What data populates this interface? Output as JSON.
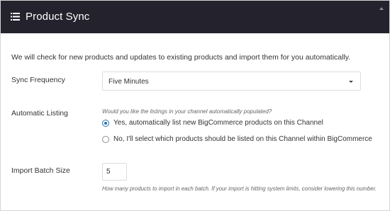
{
  "panel": {
    "title": "Product Sync",
    "header_icon": "list-icon",
    "collapse_icon": "triangle-up-icon"
  },
  "intro_text": "We will check for new products and updates to existing products and import them for you automatically.",
  "sync_frequency": {
    "label": "Sync Frequency",
    "selected": "Five Minutes"
  },
  "automatic_listing": {
    "label": "Automatic Listing",
    "question": "Would you like the listings in your channel automatically populated?",
    "options": [
      {
        "label": "Yes, automatically list new BigCommerce products on this Channel",
        "checked": true
      },
      {
        "label": "No, I'll select which products should be listed on this Channel within BigCommerce",
        "checked": false
      }
    ]
  },
  "import_batch_size": {
    "label": "Import Batch Size",
    "value": "5",
    "hint": "How many products to import in each batch. If your import is hitting system limits, consider lowering this number."
  },
  "colors": {
    "header_bg": "#24222d",
    "accent": "#2271b1"
  }
}
